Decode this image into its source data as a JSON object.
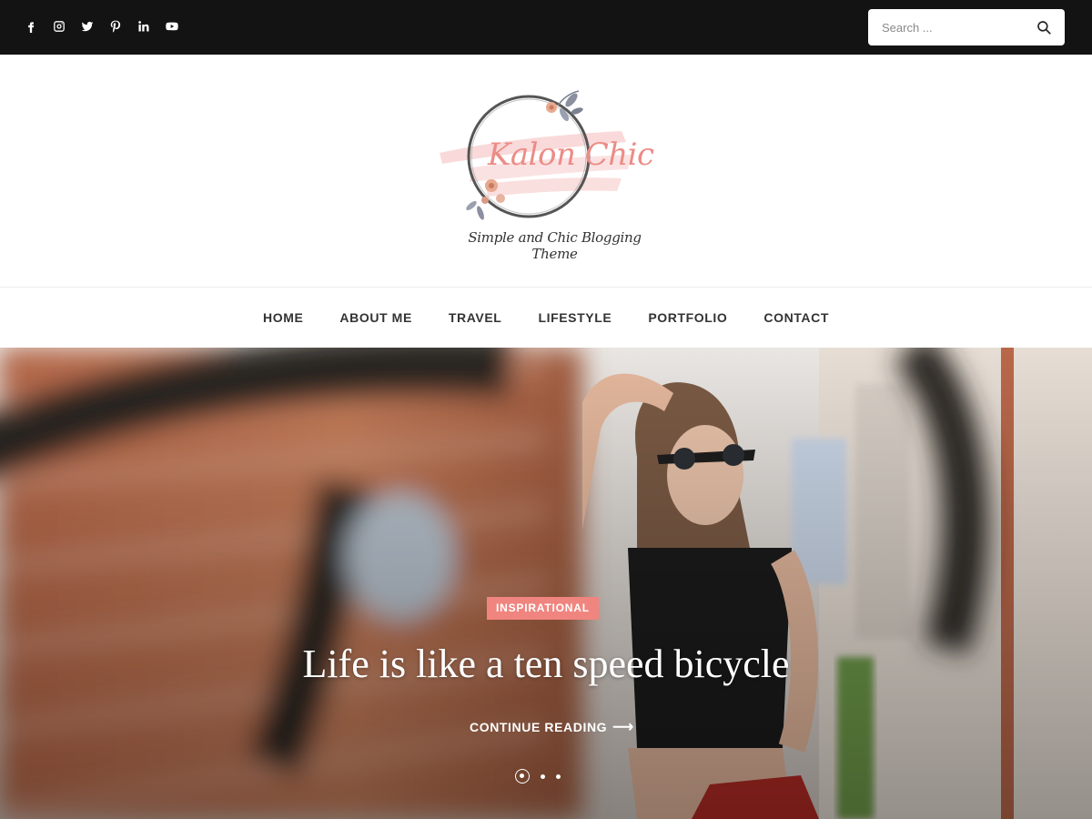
{
  "topbar": {
    "social_icons": [
      "facebook-icon",
      "instagram-icon",
      "twitter-icon",
      "pinterest-icon",
      "linkedin-icon",
      "youtube-icon"
    ],
    "search": {
      "placeholder": "Search ..."
    }
  },
  "header": {
    "logo_title": "Kalon Chic",
    "tagline": "Simple and Chic Blogging Theme"
  },
  "nav": {
    "items": [
      "HOME",
      "ABOUT ME",
      "TRAVEL",
      "LIFESTYLE",
      "PORTFOLIO",
      "CONTACT"
    ]
  },
  "hero": {
    "category": "INSPIRATIONAL",
    "title": "Life is like a ten speed bicycle",
    "cta": "CONTINUE READING",
    "slide_count": 3,
    "active_slide": 1
  },
  "colors": {
    "topbar_bg": "#131313",
    "accent": "#f0857f",
    "logo_text": "#ec8c86"
  }
}
